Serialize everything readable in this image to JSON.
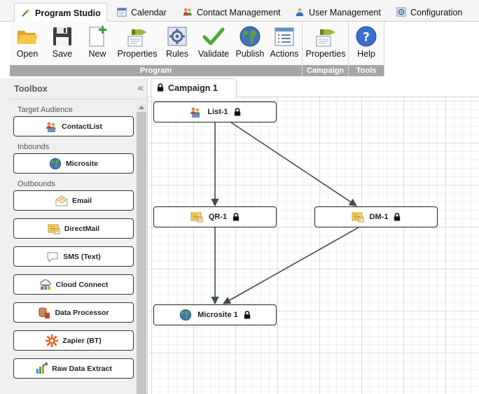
{
  "tabs": [
    {
      "label": "Program Studio",
      "icon": "wand-icon",
      "active": true
    },
    {
      "label": "Calendar",
      "icon": "calendar-icon",
      "active": false
    },
    {
      "label": "Contact Management",
      "icon": "people-icon",
      "active": false
    },
    {
      "label": "User Management",
      "icon": "user-icon",
      "active": false
    },
    {
      "label": "Configuration",
      "icon": "gear-icon",
      "active": false
    }
  ],
  "ribbon": {
    "groups": [
      {
        "label": "Program",
        "buttons": [
          {
            "label": "Open",
            "icon": "folder-icon"
          },
          {
            "label": "Save",
            "icon": "floppy-disk-icon"
          },
          {
            "label": "New",
            "icon": "new-document-icon"
          },
          {
            "label": "Properties",
            "icon": "properties-icon"
          },
          {
            "label": "Rules",
            "icon": "rules-icon"
          },
          {
            "label": "Validate",
            "icon": "checkmark-icon"
          },
          {
            "label": "Publish",
            "icon": "globe-icon"
          },
          {
            "label": "Actions",
            "icon": "actions-list-icon"
          }
        ]
      },
      {
        "label": "Campaign",
        "buttons": [
          {
            "label": "Properties",
            "icon": "properties-icon"
          }
        ]
      },
      {
        "label": "Tools",
        "buttons": [
          {
            "label": "Help",
            "icon": "help-icon"
          }
        ]
      }
    ]
  },
  "toolbox": {
    "title": "Toolbox",
    "collapse_glyph": "«",
    "sections": [
      {
        "label": "Target Audience",
        "items": [
          {
            "label": "ContactList",
            "icon": "contact-list-icon"
          }
        ]
      },
      {
        "label": "Inbounds",
        "items": [
          {
            "label": "Microsite",
            "icon": "globe-icon"
          }
        ]
      },
      {
        "label": "Outbounds",
        "items": [
          {
            "label": "Email",
            "icon": "envelope-icon"
          },
          {
            "label": "DirectMail",
            "icon": "direct-mail-icon"
          },
          {
            "label": "SMS (Text)",
            "icon": "speech-bubble-icon"
          },
          {
            "label": "Cloud Connect",
            "icon": "cloud-connect-icon"
          },
          {
            "label": "Data Processor",
            "icon": "data-processor-icon"
          },
          {
            "label": "Zapier (BT)",
            "icon": "zapier-icon"
          },
          {
            "label": "Raw Data Extract",
            "icon": "data-extract-icon"
          }
        ]
      }
    ]
  },
  "canvas": {
    "tab_label": "Campaign 1",
    "nodes": [
      {
        "id": "list-1",
        "label": "List-1",
        "icon": "contact-list-icon",
        "locked": true
      },
      {
        "id": "qr-1",
        "label": "QR-1",
        "icon": "direct-mail-icon",
        "locked": true
      },
      {
        "id": "dm-1",
        "label": "DM-1",
        "icon": "direct-mail-icon",
        "locked": true
      },
      {
        "id": "microsite-1",
        "label": "Microsite 1",
        "icon": "globe-icon",
        "locked": true
      }
    ],
    "edges": [
      {
        "from": "list-1",
        "to": "qr-1"
      },
      {
        "from": "list-1",
        "to": "dm-1"
      },
      {
        "from": "qr-1",
        "to": "microsite-1"
      },
      {
        "from": "dm-1",
        "to": "microsite-1"
      }
    ]
  },
  "colors": {
    "accent_blue": "#3a6fb5",
    "group_label_bg": "#a6a6a6",
    "edge": "#3f4d48"
  }
}
